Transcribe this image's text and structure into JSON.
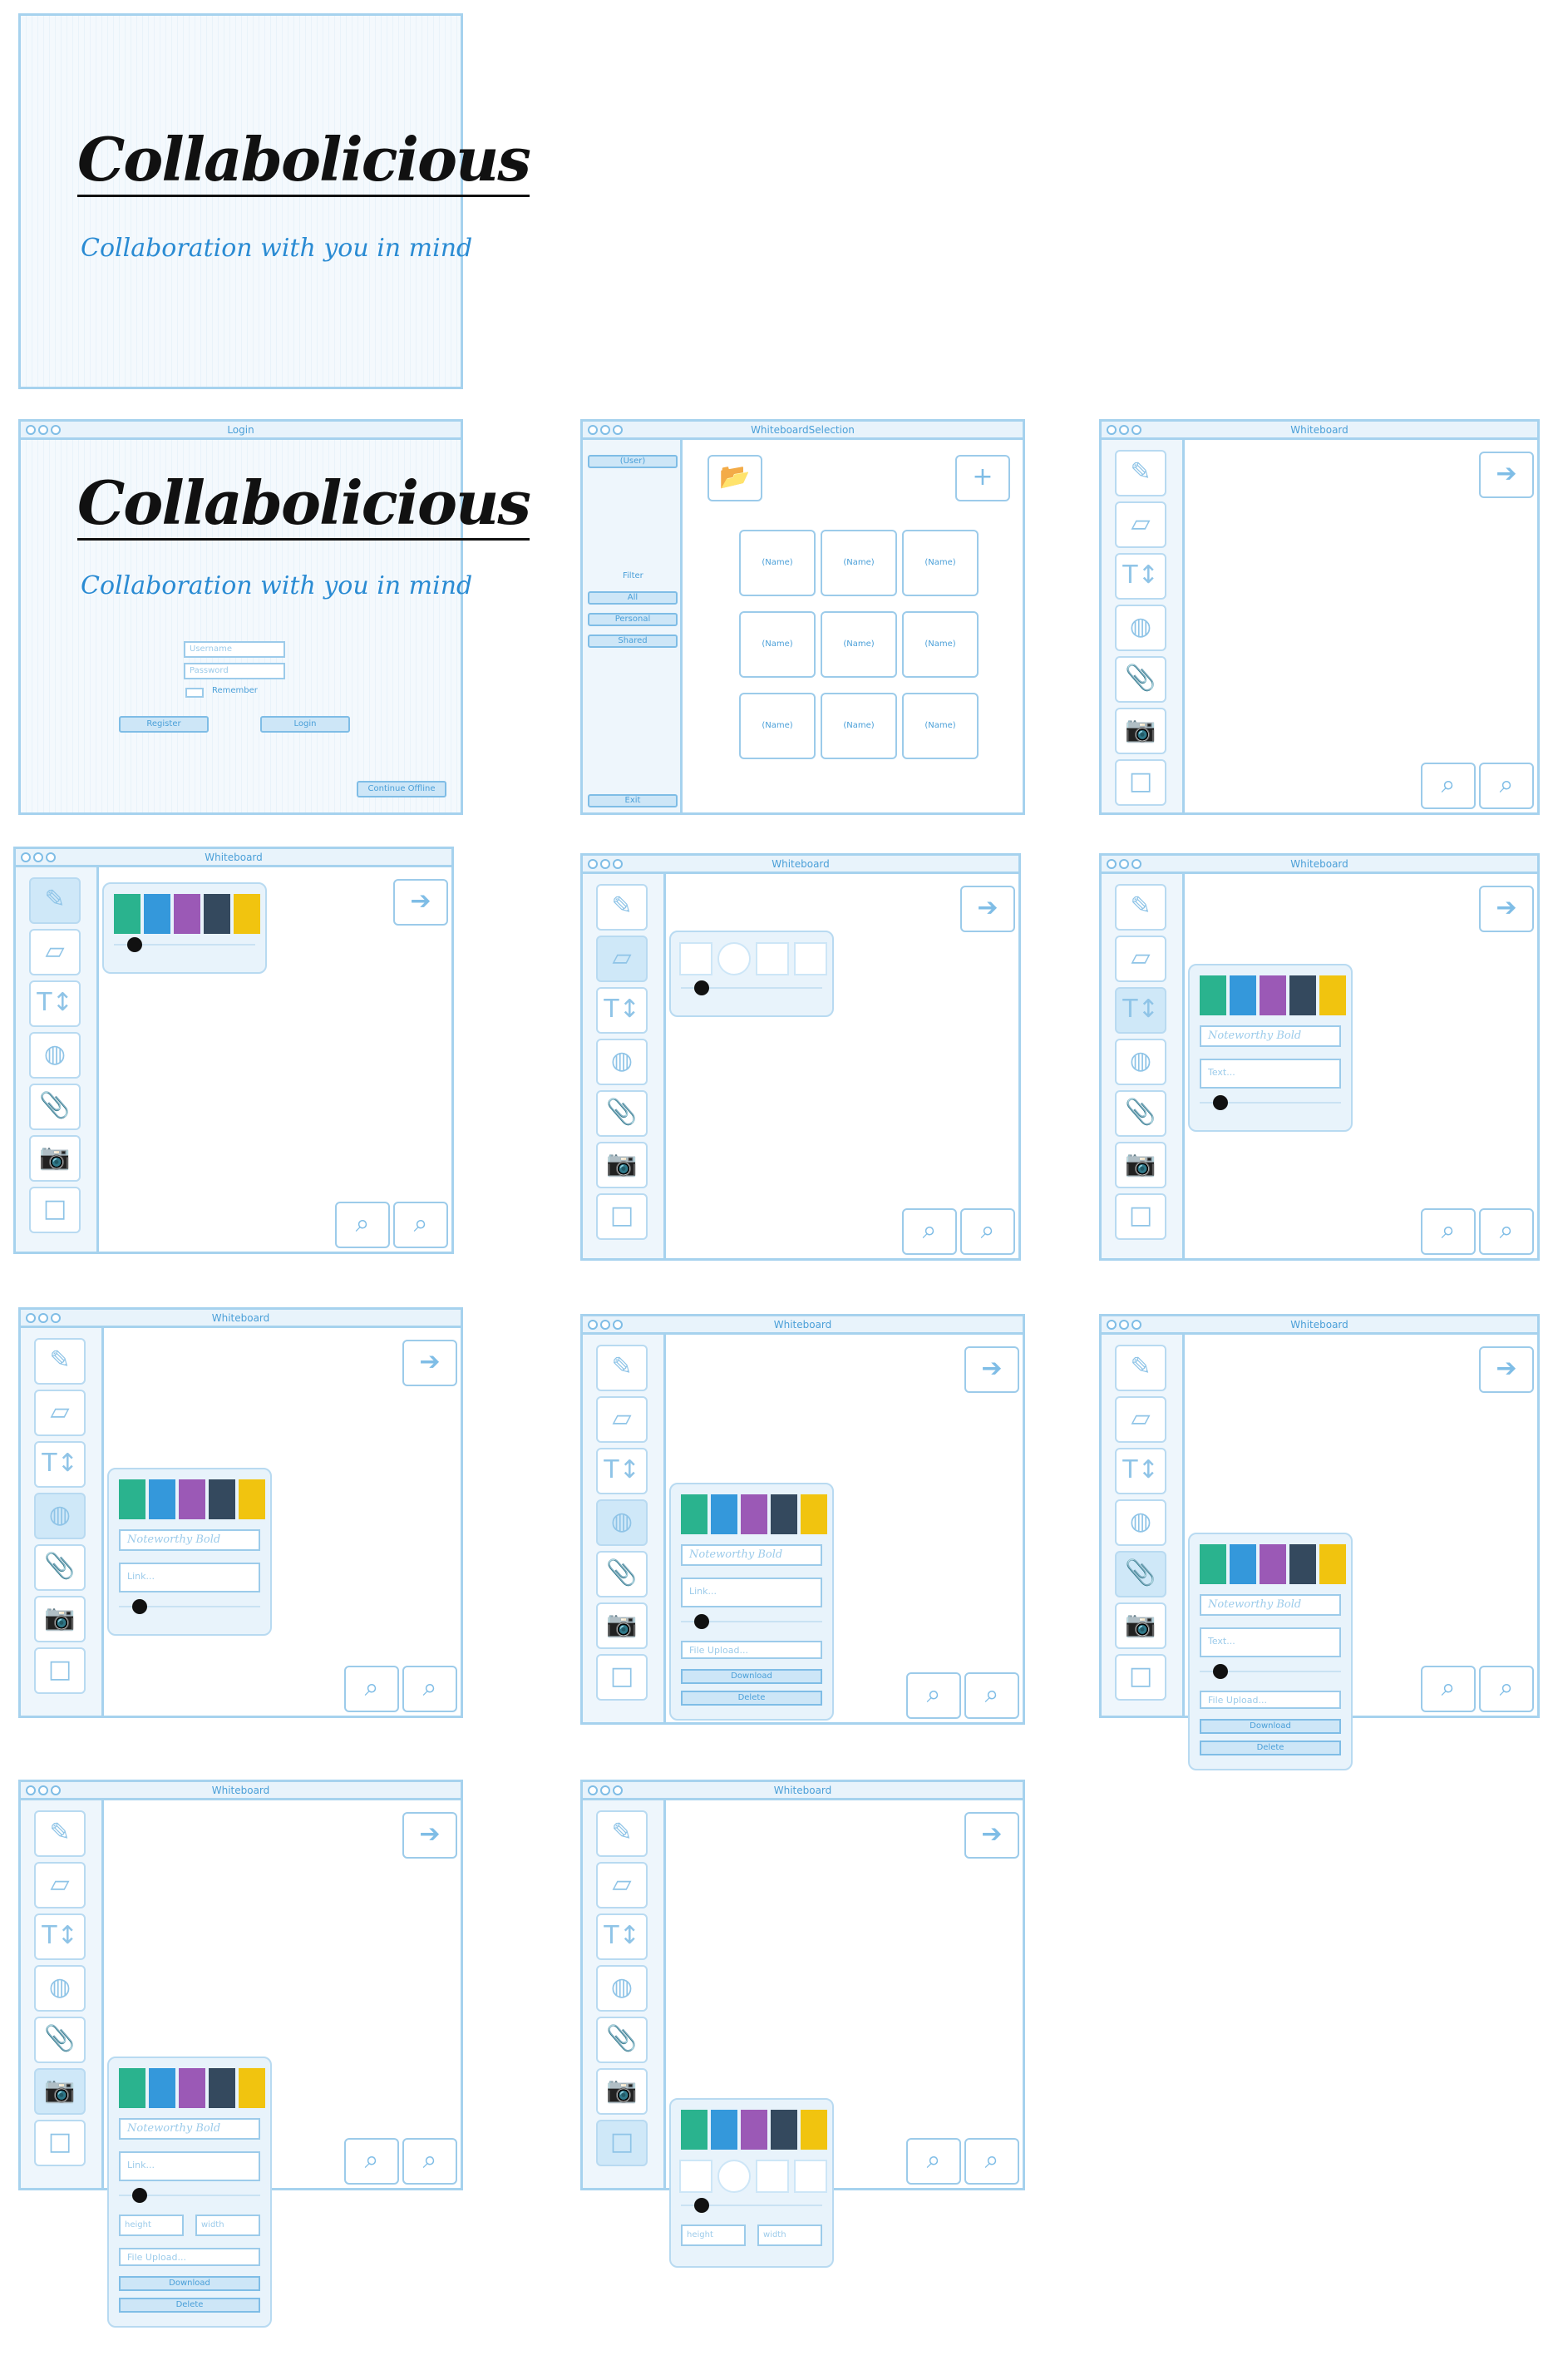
{
  "splash": {
    "brand": "Collabolicious",
    "tagline": "Collaboration with  you in mind"
  },
  "login": {
    "title": "Login",
    "brand": "Collabolicious",
    "tagline": "Collaboration with  you in mind",
    "username_placeholder": "Username",
    "password_placeholder": "Password",
    "remember_label": "Remember",
    "register_label": "Register",
    "login_label": "Login",
    "offline_label": "Continue Offline"
  },
  "selection": {
    "title": "WhiteboardSelection",
    "user_label": "(User)",
    "filter_label": "Filter",
    "filters": [
      "All",
      "Personal",
      "Shared"
    ],
    "exit_label": "Exit",
    "tiles": [
      "(Name)",
      "(Name)",
      "(Name)",
      "(Name)",
      "(Name)",
      "(Name)",
      "(Name)",
      "(Name)",
      "(Name)"
    ]
  },
  "whiteboard": {
    "title": "Whiteboard",
    "font_name": "Noteworthy Bold",
    "text_placeholder": "Text...",
    "link_placeholder": "Link...",
    "file_placeholder": "File Upload...",
    "height_label": "height",
    "width_label": "width",
    "download_label": "Download",
    "delete_label": "Delete"
  },
  "tools": [
    "pencil-icon",
    "eraser-icon",
    "text-icon",
    "globe-icon",
    "paperclip-icon",
    "camera-icon",
    "square-icon"
  ],
  "palette": [
    "#2ab38e",
    "#3498db",
    "#9b59b6",
    "#34495e",
    "#f1c40f"
  ]
}
